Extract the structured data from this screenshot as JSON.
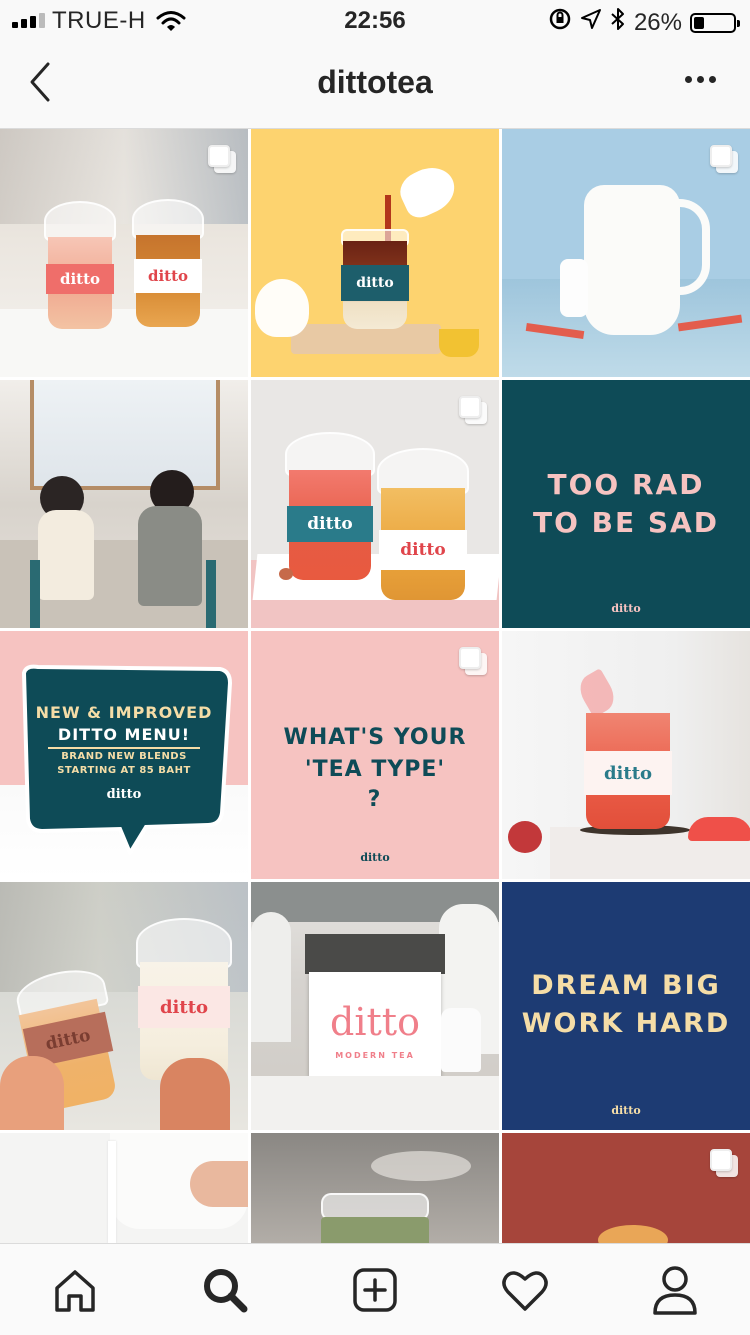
{
  "status_bar": {
    "carrier": "TRUE-H",
    "time": "22:56",
    "battery_percent": "26%",
    "battery_level": 0.26
  },
  "header": {
    "title": "dittotea",
    "back_icon": "chevron-left-icon",
    "more_icon": "more-horizontal-icon"
  },
  "posts": {
    "cup_brand": "ditto",
    "cup_sub": "MODERN TEA",
    "poster_too_rad": {
      "line1": "TOO RAD",
      "line2": "TO BE SAD",
      "logo": "ditto"
    },
    "poster_menu": {
      "line1": "NEW & IMPROVED",
      "line2": "DITTO MENU!",
      "line3": "BRAND NEW BLENDS",
      "line4": "STARTING AT 85 BAHT",
      "logo": "ditto"
    },
    "poster_tea_type": {
      "line1": "WHAT'S YOUR",
      "line2": "'TEA TYPE'",
      "line3": "?",
      "logo": "ditto"
    },
    "poster_dream": {
      "line1": "DREAM BIG",
      "line2": "WORK HARD",
      "logo": "ditto"
    },
    "counter_sign": {
      "brand": "ditto",
      "sub": "MODERN TEA"
    }
  },
  "tab_bar": {
    "items": [
      "home-icon",
      "search-icon",
      "new-post-icon",
      "activity-heart-icon",
      "profile-icon"
    ]
  },
  "colors": {
    "teal": "#0e4b57",
    "pink": "#f6c3c1",
    "navy": "#1d3b73",
    "cream": "#f5dda7",
    "brick": "#a6453b",
    "yellow": "#fdd36f",
    "sky": "#a9cde4"
  }
}
